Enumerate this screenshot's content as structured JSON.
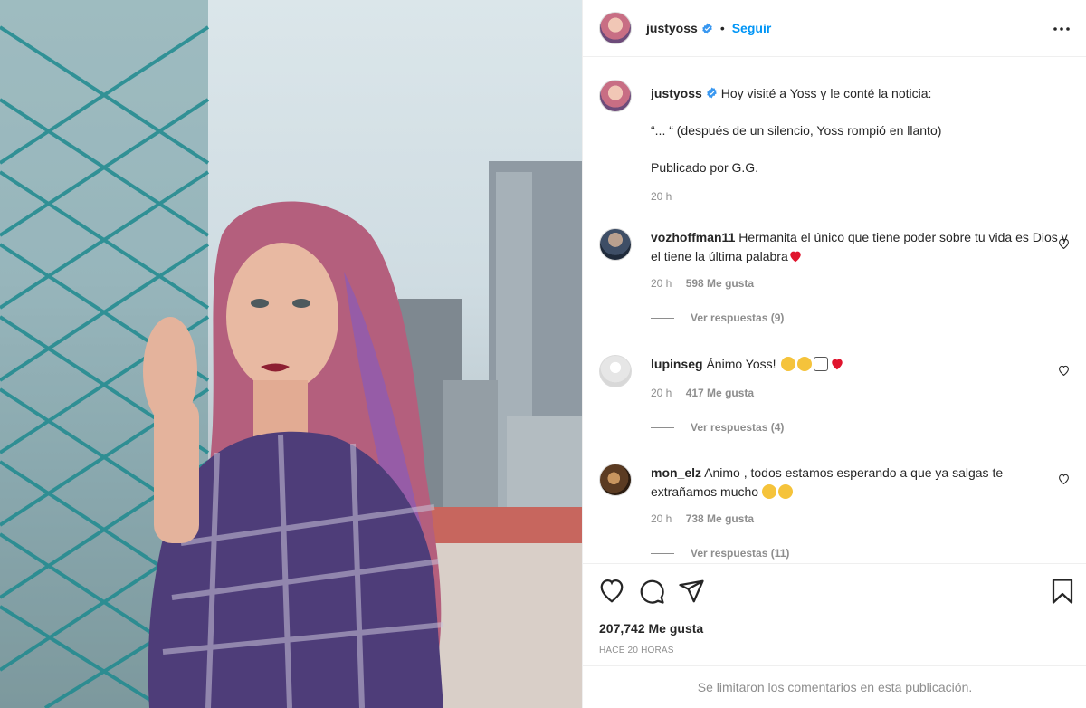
{
  "post": {
    "author": "justyoss",
    "follow_label": "Seguir",
    "dot": "•",
    "caption": {
      "line1": "Hoy visité a Yoss y le conté la noticia:",
      "line2": "“... “ (después de un silencio, Yoss rompió en llanto)",
      "line3": "Publicado por G.G.",
      "time": "20 h"
    }
  },
  "comments": [
    {
      "user": "vozhoffman11",
      "text": "Hermanita el único que tiene poder sobre tu vida es Dios y el tiene la última palabra",
      "emoji": [
        "red-heart"
      ],
      "time": "20 h",
      "likes": "598 Me gusta",
      "replies": "Ver respuestas (9)"
    },
    {
      "user": "lupinseg",
      "text": "Ánimo Yoss!",
      "emoji": [
        "rolling-eyes-face",
        "hushed-face",
        "backhand-index-left",
        "red-heart"
      ],
      "time": "20 h",
      "likes": "417 Me gusta",
      "replies": "Ver respuestas (4)"
    },
    {
      "user": "mon_elz",
      "text": "Animo , todos estamos esperando a que ya salgas te extrañamos mucho",
      "emoji": [
        "sad-face",
        "sad-face"
      ],
      "time": "20 h",
      "likes": "738 Me gusta",
      "replies": "Ver respuestas (11)"
    }
  ],
  "footer": {
    "likes_total": "207,742 Me gusta",
    "posted": "HACE 20 HORAS",
    "comments_limited": "Se limitaron los comentarios en esta publicación."
  },
  "colors": {
    "accent": "#0095f6",
    "verified": "#3897f0",
    "muted": "#8e8e8e",
    "heart": "#ed4956"
  }
}
